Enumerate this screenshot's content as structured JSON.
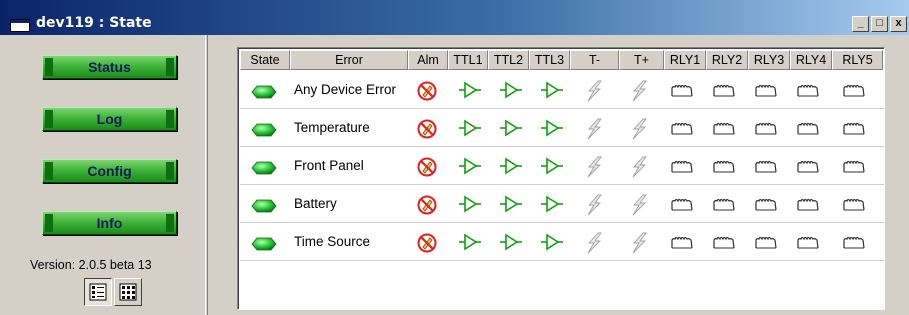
{
  "window": {
    "title": "dev119 : State"
  },
  "titlebar_buttons": [
    "_",
    "□",
    "x"
  ],
  "nav": {
    "status": "Status",
    "log": "Log",
    "config": "Config",
    "info": "Info"
  },
  "version": "Version: 2.0.5 beta 13",
  "table": {
    "columns": [
      "State",
      "Error",
      "Alm",
      "TTL1",
      "TTL2",
      "TTL3",
      "T-",
      "T+",
      "RLY1",
      "RLY2",
      "RLY3",
      "RLY4",
      "RLY5"
    ],
    "rows": [
      {
        "state": "ok",
        "error": "Any Device Error"
      },
      {
        "state": "ok",
        "error": "Temperature"
      },
      {
        "state": "ok",
        "error": "Front Panel"
      },
      {
        "state": "ok",
        "error": "Battery"
      },
      {
        "state": "ok",
        "error": "Time Source"
      }
    ]
  },
  "colors": {
    "led_ok": "#2ecc40",
    "alarm": "#e02020",
    "ttl": "#10a010",
    "relay": "#303030"
  }
}
